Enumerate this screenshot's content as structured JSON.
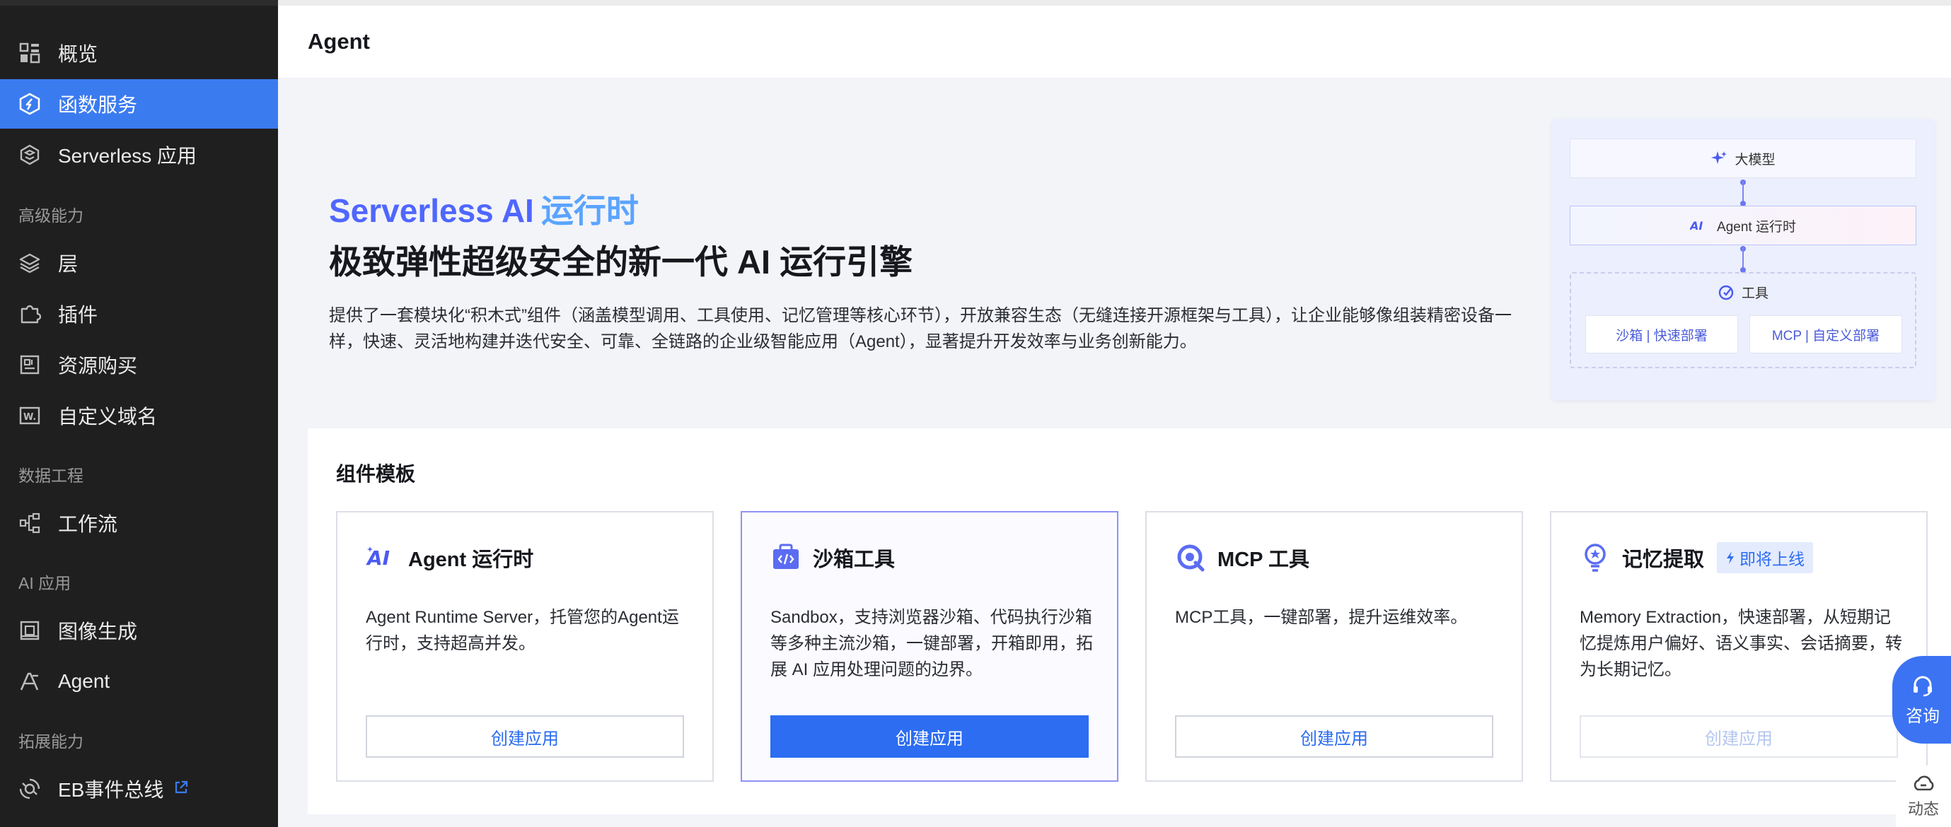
{
  "sidebar": {
    "items": [
      {
        "label": "概览",
        "icon": "grid-icon"
      },
      {
        "label": "函数服务",
        "icon": "function-icon",
        "active": true
      },
      {
        "label": "Serverless 应用",
        "icon": "serverless-icon"
      }
    ],
    "groups": [
      {
        "title": "高级能力",
        "items": [
          {
            "label": "层",
            "icon": "layers-icon"
          },
          {
            "label": "插件",
            "icon": "plugin-icon"
          },
          {
            "label": "资源购买",
            "icon": "resource-icon"
          },
          {
            "label": "自定义域名",
            "icon": "domain-icon"
          }
        ]
      },
      {
        "title": "数据工程",
        "items": [
          {
            "label": "工作流",
            "icon": "workflow-icon"
          }
        ]
      },
      {
        "title": "AI 应用",
        "items": [
          {
            "label": "图像生成",
            "icon": "image-icon"
          },
          {
            "label": "Agent",
            "icon": "agent-icon"
          }
        ]
      },
      {
        "title": "拓展能力",
        "items": [
          {
            "label": "EB事件总线",
            "icon": "eventbus-icon",
            "external": true
          }
        ]
      }
    ]
  },
  "header": {
    "title": "Agent"
  },
  "hero": {
    "title_part1": "Serverless AI",
    "title_part2": "运行时",
    "subtitle": "极致弹性超级安全的新一代 AI 运行引擎",
    "description": "提供了一套模块化“积木式”组件（涵盖模型调用、工具使用、记忆管理等核心环节），开放兼容生态（无缝连接开源框架与工具），让企业能够像组装精密设备一样，快速、灵活地构建并迭代安全、可靠、全链路的企业级智能应用（Agent），显著提升开发效率与业务创新能力。"
  },
  "diagram": {
    "model": "大模型",
    "agent": "Agent 运行时",
    "tools": "工具",
    "sandbox": "沙箱 | 快速部署",
    "mcp": "MCP | 自定义部署"
  },
  "templates": {
    "title": "组件模板",
    "items": [
      {
        "name": "Agent 运行时",
        "description": "Agent Runtime Server，托管您的Agent运行时，支持超高并发。",
        "button": "创建应用"
      },
      {
        "name": "沙箱工具",
        "description": "Sandbox，支持浏览器沙箱、代码执行沙箱等多种主流沙箱，一键部署，开箱即用，拓展 AI 应用处理问题的边界。",
        "button": "创建应用"
      },
      {
        "name": "MCP 工具",
        "description": "MCP工具，一键部署，提升运维效率。",
        "button": "创建应用"
      },
      {
        "name": "记忆提取",
        "badge": "即将上线",
        "description": "Memory Extraction，快速部署，从短期记忆提炼用户偏好、语义事实、会话摘要，转为长期记忆。",
        "button": "创建应用"
      }
    ]
  },
  "floating": {
    "consult": "咨询",
    "dynamic": "动态"
  },
  "colors": {
    "accent": "#2c6df2",
    "sidebar_bg": "#1f1f1f",
    "active_nav": "#3b7bf0"
  }
}
